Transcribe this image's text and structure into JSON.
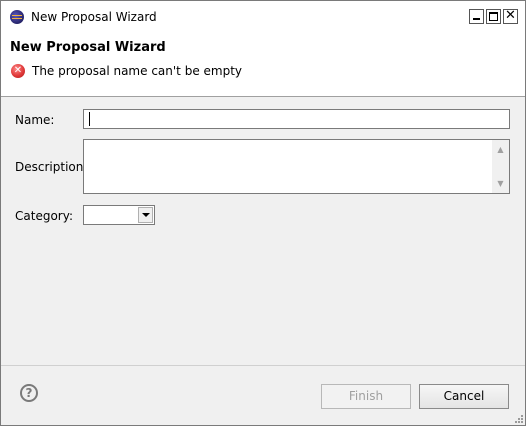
{
  "window": {
    "title": "New Proposal Wizard"
  },
  "header": {
    "title": "New Proposal Wizard",
    "error_message": "The proposal name can't be empty",
    "error_icon": "error-icon"
  },
  "form": {
    "name_label": "Name:",
    "name_value": "",
    "description_label": "Description:",
    "description_value": "",
    "category_label": "Category:",
    "category_value": ""
  },
  "footer": {
    "help_icon": "help-icon",
    "finish_label": "Finish",
    "cancel_label": "Cancel"
  },
  "colors": {
    "error_red": "#e03a3a",
    "disabled_text": "#a0a0a0"
  }
}
